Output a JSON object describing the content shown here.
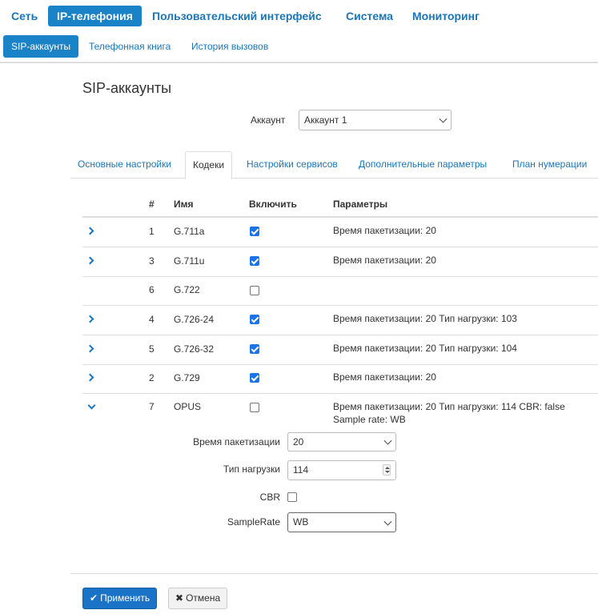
{
  "topnav": {
    "items": [
      "Сеть",
      "IP-телефония",
      "Пользовательский интерфейс",
      "Система",
      "Мониторинг"
    ],
    "active": 1
  },
  "subnav": {
    "items": [
      "SIP-аккаунты",
      "Телефонная книга",
      "История вызовов"
    ],
    "active": 0
  },
  "page": {
    "title": "SIP-аккаунты"
  },
  "account": {
    "label": "Аккаунт",
    "value": "Аккаунт 1"
  },
  "tabs": {
    "items": [
      "Основные настройки",
      "Кодеки",
      "Настройки сервисов",
      "Дополнительные параметры",
      "План нумерации"
    ],
    "active": 1
  },
  "table": {
    "headers": {
      "num": "#",
      "name": "Имя",
      "enable": "Включить",
      "params": "Параметры"
    },
    "rows": [
      {
        "num": "1",
        "name": "G.711a",
        "enabled": true,
        "expandable": true,
        "expanded": false,
        "params": "Время пакетизации: 20"
      },
      {
        "num": "3",
        "name": "G.711u",
        "enabled": true,
        "expandable": true,
        "expanded": false,
        "params": "Время пакетизации: 20"
      },
      {
        "num": "6",
        "name": "G.722",
        "enabled": false,
        "expandable": false,
        "expanded": false,
        "params": ""
      },
      {
        "num": "4",
        "name": "G.726-24",
        "enabled": true,
        "expandable": true,
        "expanded": false,
        "params": "Время пакетизации: 20 Тип нагрузки: 103"
      },
      {
        "num": "5",
        "name": "G.726-32",
        "enabled": true,
        "expandable": true,
        "expanded": false,
        "params": "Время пакетизации: 20 Тип нагрузки: 104"
      },
      {
        "num": "2",
        "name": "G.729",
        "enabled": true,
        "expandable": true,
        "expanded": false,
        "params": "Время пакетизации: 20"
      },
      {
        "num": "7",
        "name": "OPUS",
        "enabled": false,
        "expandable": true,
        "expanded": true,
        "params": "Время пакетизации: 20 Тип нагрузки: 114 CBR: false",
        "params2": "Sample rate: WB"
      }
    ]
  },
  "opus_details": {
    "ptime_label": "Время пакетизации",
    "ptime_value": "20",
    "payload_label": "Тип нагрузки",
    "payload_value": "114",
    "cbr_label": "CBR",
    "cbr_checked": false,
    "samplerate_label": "SampleRate",
    "samplerate_value": "WB"
  },
  "buttons": {
    "apply": {
      "icon": "check-icon",
      "label": "Применить"
    },
    "cancel": {
      "icon": "close-icon",
      "label": "Отмена"
    }
  },
  "colors": {
    "accent": "#1a82c6",
    "link": "#1a76b8",
    "checkbox": "#1a73e8"
  }
}
